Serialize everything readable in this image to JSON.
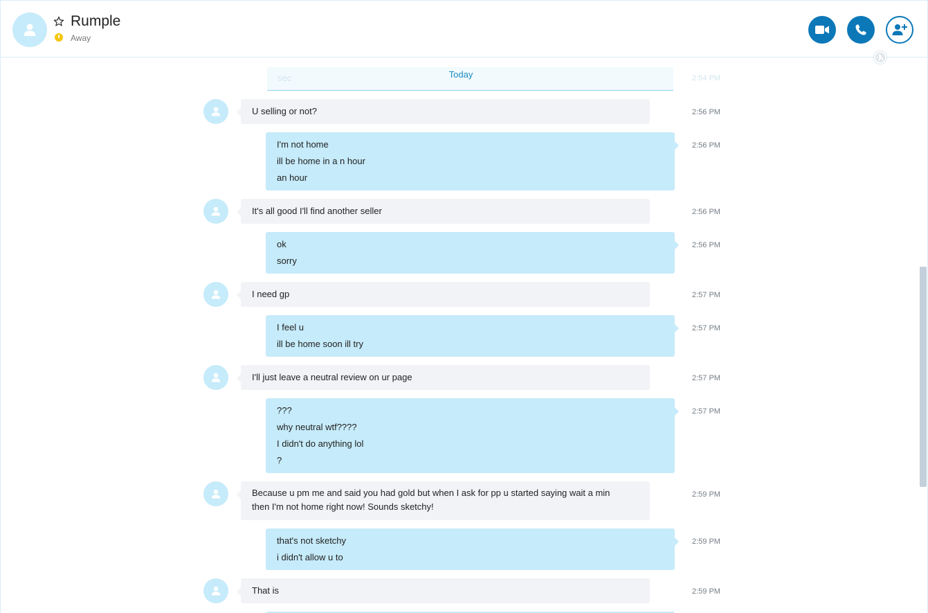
{
  "header": {
    "contact_name": "Rumple",
    "status": "Away"
  },
  "icons": {
    "avatar": "person-icon",
    "favorite": "star-outline-icon",
    "status": "clock-icon",
    "video": "video-camera-icon",
    "call": "phone-icon",
    "add_people": "add-person-icon",
    "globe": "globe-icon"
  },
  "colors": {
    "accent": "#0c78b8",
    "outgoing_bubble": "#c6ebfa",
    "incoming_bubble": "#f1f3f6",
    "status_away": "#f5c60e",
    "day_separator": "#1a8dc2"
  },
  "chat": {
    "day_separator": "Today",
    "faded_message": {
      "text": "sec",
      "time": "2:54 PM"
    },
    "messages": [
      {
        "direction": "in",
        "lines": [
          "U selling or not?"
        ],
        "time": "2:56 PM"
      },
      {
        "direction": "out",
        "lines": [
          "I'm not home",
          "ill be home in a n hour",
          "an hour"
        ],
        "time": "2:56 PM"
      },
      {
        "direction": "in",
        "lines": [
          "It's all good I'll find another seller"
        ],
        "time": "2:56 PM"
      },
      {
        "direction": "out",
        "lines": [
          "ok",
          "sorry"
        ],
        "time": "2:56 PM"
      },
      {
        "direction": "in",
        "lines": [
          "I need gp"
        ],
        "time": "2:57 PM"
      },
      {
        "direction": "out",
        "lines": [
          "I feel u",
          "ill be home soon ill try"
        ],
        "time": "2:57 PM"
      },
      {
        "direction": "in",
        "lines": [
          "I'll just leave a neutral review on ur page"
        ],
        "time": "2:57 PM"
      },
      {
        "direction": "out",
        "lines": [
          "???",
          "why neutral wtf????",
          "I didn't do anything lol",
          "?"
        ],
        "time": "2:57 PM"
      },
      {
        "direction": "in",
        "lines": [
          "Because u pm me and said you had gold but when I ask for pp u started saying wait a min then I'm not home right now! Sounds sketchy!"
        ],
        "time": "2:59 PM"
      },
      {
        "direction": "out",
        "lines": [
          "that's not sketchy",
          "i didn't allow u to"
        ],
        "time": "2:59 PM"
      },
      {
        "direction": "in",
        "lines": [
          "That is"
        ],
        "time": "2:59 PM"
      }
    ]
  }
}
